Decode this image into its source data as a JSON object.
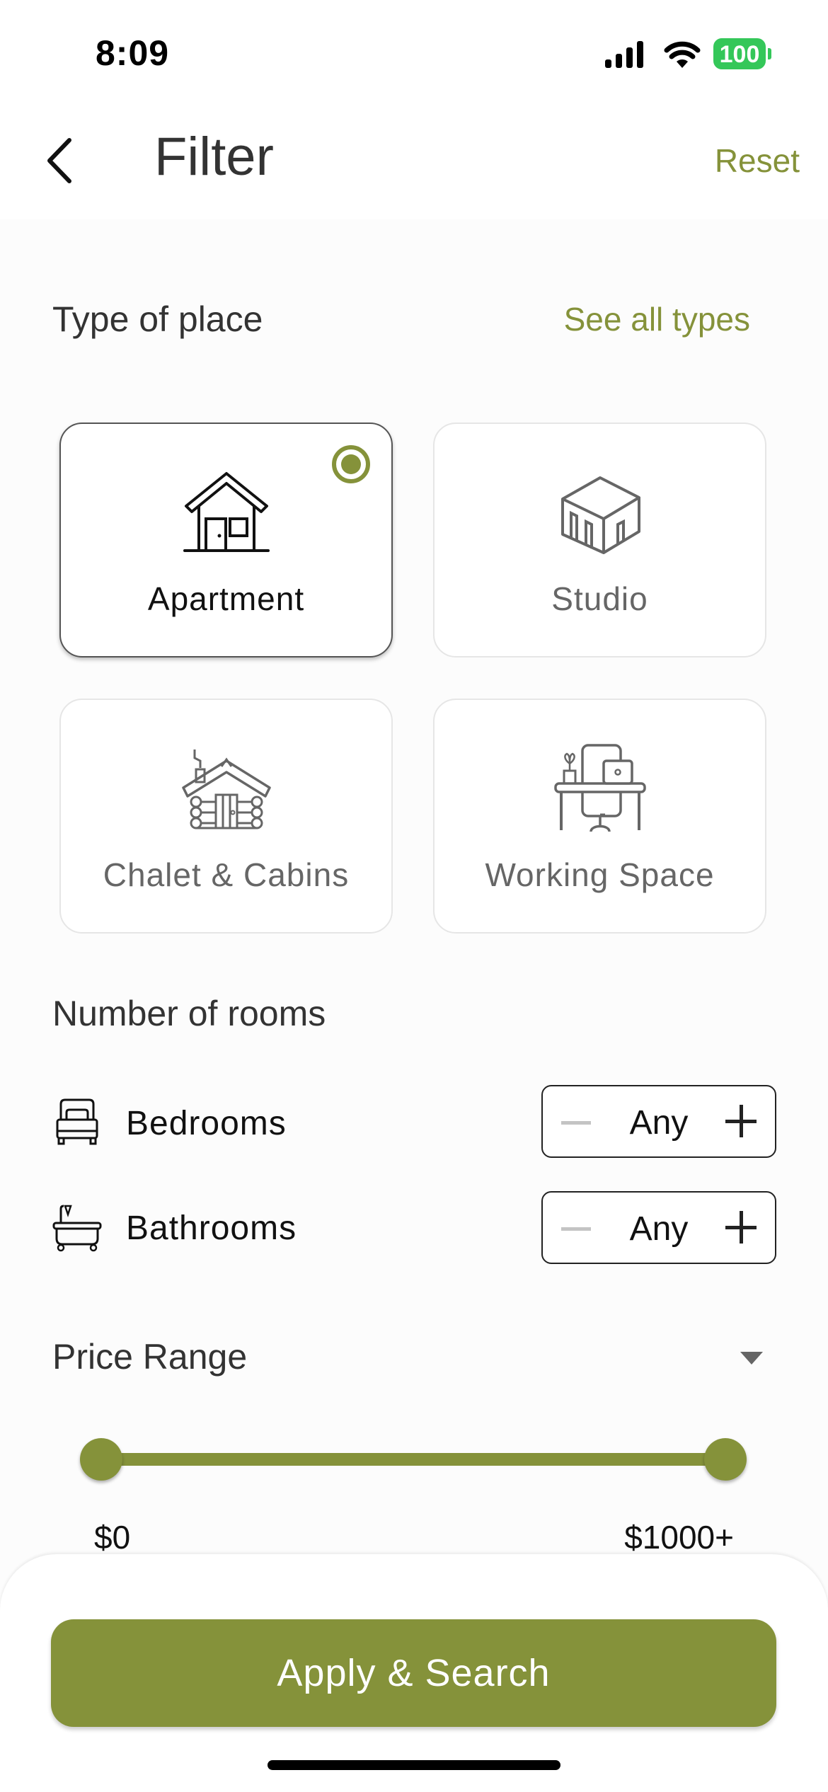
{
  "status_bar": {
    "time": "8:09",
    "battery": "100",
    "signal_icon": "cellular-signal-icon",
    "wifi_icon": "wifi-icon",
    "battery_icon": "battery-icon"
  },
  "header": {
    "title": "Filter",
    "reset_label": "Reset",
    "back_icon": "chevron-left-icon"
  },
  "type_of_place": {
    "title": "Type of place",
    "see_all_label": "See all types",
    "options": [
      {
        "label": "Apartment",
        "icon": "house-icon",
        "selected": true
      },
      {
        "label": "Studio",
        "icon": "studio-building-icon",
        "selected": false
      },
      {
        "label": "Chalet & Cabins",
        "icon": "log-cabin-icon",
        "selected": false
      },
      {
        "label": "Working Space",
        "icon": "desk-workspace-icon",
        "selected": false
      }
    ]
  },
  "rooms": {
    "title": "Number of rooms",
    "rows": [
      {
        "label": "Bedrooms",
        "icon": "bed-icon",
        "value": "Any"
      },
      {
        "label": "Bathrooms",
        "icon": "bathtub-icon",
        "value": "Any"
      }
    ]
  },
  "price_range": {
    "title": "Price Range",
    "min_label": "$0",
    "max_label": "$1000+",
    "selected_min_fraction": 0.0,
    "selected_max_fraction": 1.0
  },
  "footer": {
    "apply_label": "Apply & Search"
  },
  "colors": {
    "accent": "#85923a",
    "text": "#333333",
    "muted": "#666666"
  }
}
